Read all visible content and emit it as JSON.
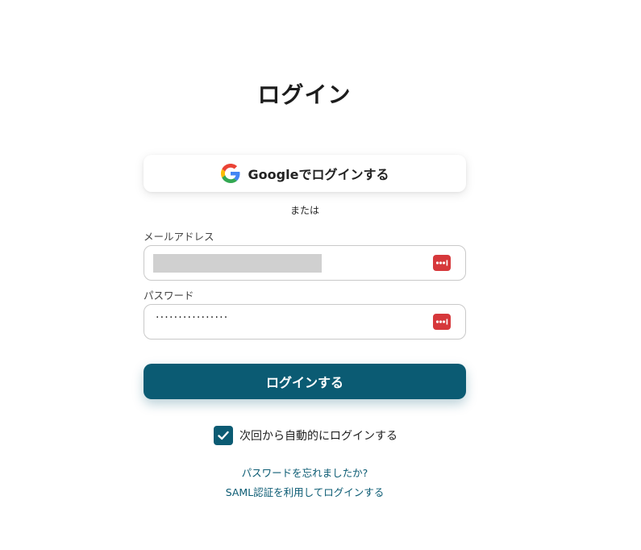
{
  "page": {
    "title": "ログイン"
  },
  "google_login": {
    "label": "Googleでログインする"
  },
  "divider": {
    "text": "または"
  },
  "email": {
    "label": "メールアドレス",
    "value": ""
  },
  "password": {
    "label": "パスワード",
    "masked_value": "················"
  },
  "submit": {
    "label": "ログインする"
  },
  "remember_me": {
    "label": "次回から自動的にログインする",
    "checked": true
  },
  "links": {
    "forgot_password": "パスワードを忘れましたか?",
    "saml_login": "SAML認証を利用してログインする"
  },
  "colors": {
    "primary": "#0b5b73",
    "password_manager_icon": "#d6383b"
  }
}
